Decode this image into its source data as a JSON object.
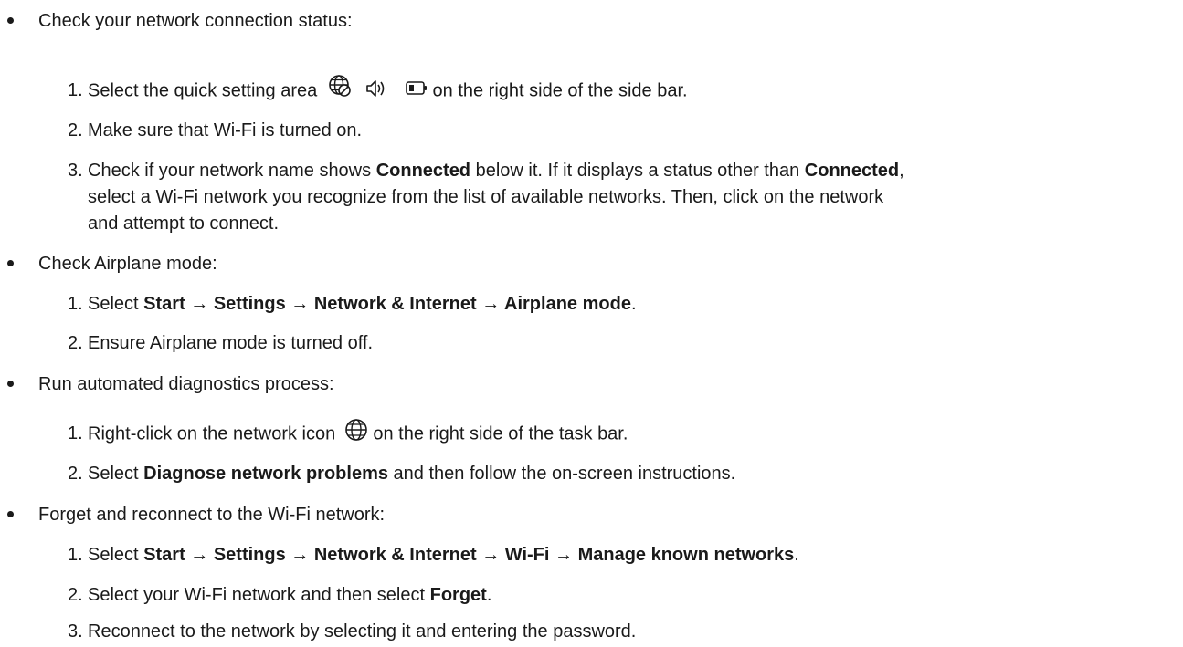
{
  "sections": [
    {
      "heading": "Check your network connection status:",
      "steps": {
        "s1_a": "Select the quick setting area",
        "s1_b": "on the right side of the side bar.",
        "s2": "Make sure that Wi-Fi is turned on.",
        "s3_a": "Check if your network name shows ",
        "s3_b": "Connected",
        "s3_c": " below it. If it displays a status other than ",
        "s3_d": "Connected",
        "s3_e": ",",
        "s3_f": "select a Wi-Fi network you recognize from the list of available networks. Then, click on the network",
        "s3_g": "and attempt to connect."
      }
    },
    {
      "heading": "Check Airplane mode:",
      "steps": {
        "s1_a": "Select ",
        "s1_b": "Start → Settings → Network & Internet → Airplane mode",
        "s1_c": ".",
        "s2": "Ensure Airplane mode is turned off."
      }
    },
    {
      "heading": "Run automated diagnostics process:",
      "steps": {
        "s1_a": "Right-click on the network icon",
        "s1_b": "on the right side of the task bar.",
        "s2_a": "Select ",
        "s2_b": "Diagnose network problems",
        "s2_c": " and then follow the on-screen instructions."
      }
    },
    {
      "heading": "Forget and reconnect to the Wi-Fi network:",
      "steps": {
        "s1_a": "Select ",
        "s1_b": "Start → Settings → Network & Internet → Wi-Fi → Manage known networks",
        "s1_c": ".",
        "s2_a": "Select your Wi-Fi network and then select ",
        "s2_b": "Forget",
        "s2_c": ".",
        "s3": "Reconnect to the network by selecting it and entering the password."
      }
    }
  ],
  "numbers": [
    "1.",
    "2.",
    "3."
  ],
  "icons": {
    "quick_settings": [
      "globe-blocked-icon",
      "speaker-icon",
      "battery-icon"
    ],
    "network": "globe-icon"
  }
}
